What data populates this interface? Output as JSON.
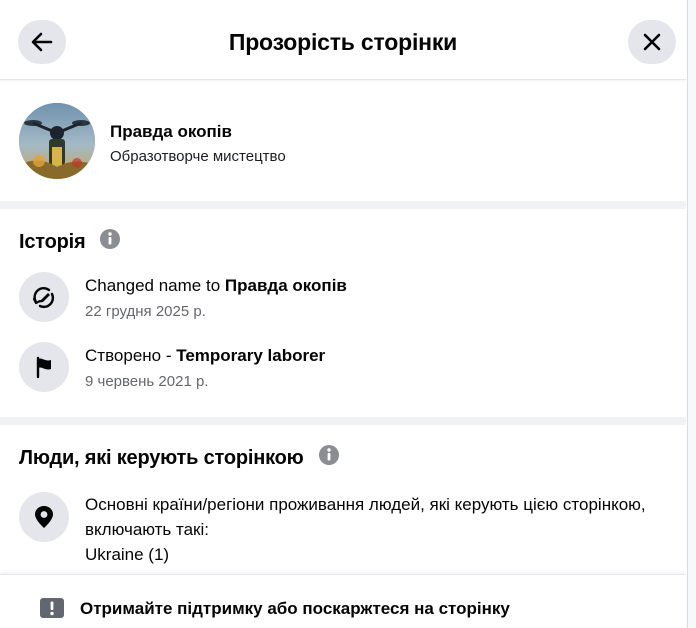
{
  "header": {
    "title": "Прозорість сторінки",
    "back_icon": "arrow-left-icon",
    "close_icon": "close-icon"
  },
  "profile": {
    "name": "Правда окопів",
    "category": "Образотворче мистецтво"
  },
  "history": {
    "title": "Історія",
    "items": [
      {
        "icon": "name-change-icon",
        "prefix": "Changed name to ",
        "bold": "Правда окопів",
        "date": "22 грудня 2025 р."
      },
      {
        "icon": "flag-icon",
        "prefix": "Створено - ",
        "bold": "Temporary laborer",
        "date": "9 червень 2021 р."
      }
    ]
  },
  "people": {
    "title": "Люди, які керують сторінкою",
    "location_text": "Основні країни/регіони проживання людей, які керують цією сторінкою, включають такі:",
    "location_value": "Ukraine (1)"
  },
  "footer": {
    "text": "Отримайте підтримку або поскаржтеся на сторінку",
    "icon": "report-icon"
  },
  "colors": {
    "secondary_text": "#65676b",
    "button_bg": "#e4e6eb",
    "divider": "#f0f2f5"
  }
}
